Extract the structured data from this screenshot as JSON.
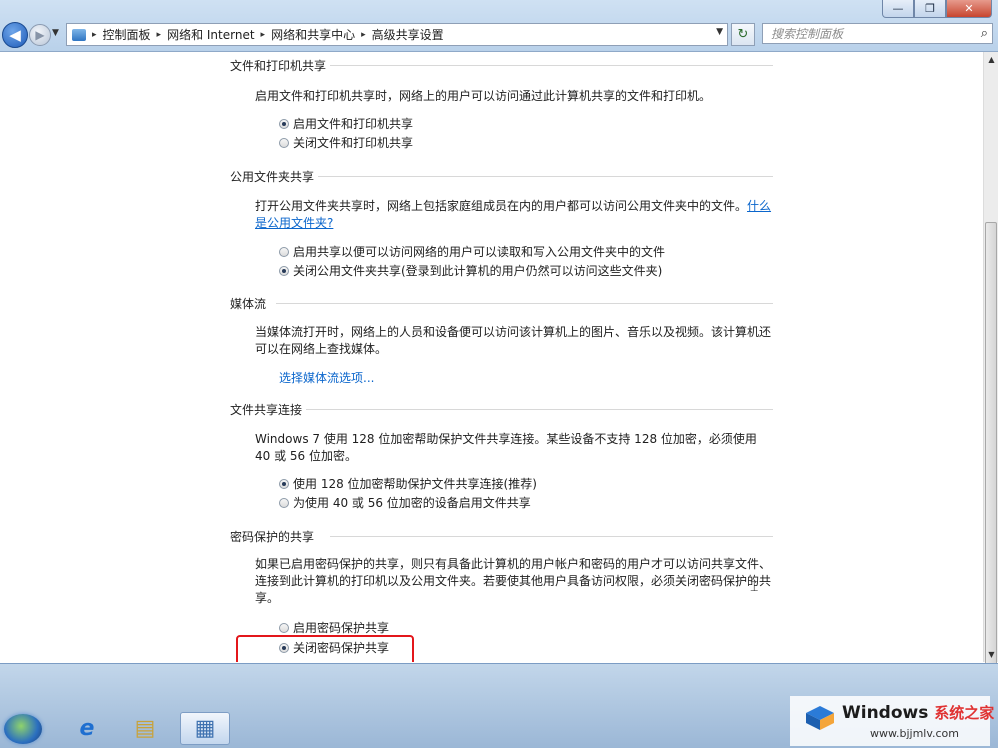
{
  "window": {
    "min_glyph": "—",
    "max_glyph": "❐",
    "close_glyph": "✕"
  },
  "nav": {
    "back_glyph": "◀",
    "fwd_glyph": "▶",
    "hist_glyph": "▼",
    "refresh_glyph": "↻",
    "search_glyph": "⌕"
  },
  "breadcrumb": {
    "sep": "▸",
    "items": [
      "控制面板",
      "网络和 Internet",
      "网络和共享中心",
      "高级共享设置"
    ],
    "dropdown_glyph": "▼"
  },
  "search": {
    "placeholder": "搜索控制面板"
  },
  "sections": [
    {
      "title": "文件和打印机共享",
      "desc": "启用文件和打印机共享时，网络上的用户可以访问通过此计算机共享的文件和打印机。",
      "options": [
        {
          "label": "启用文件和打印机共享",
          "selected": true
        },
        {
          "label": "关闭文件和打印机共享",
          "selected": false
        }
      ]
    },
    {
      "title": "公用文件夹共享",
      "desc": "打开公用文件夹共享时，网络上包括家庭组成员在内的用户都可以访问公用文件夹中的文件。",
      "link": "什么是公用文件夹?",
      "options": [
        {
          "label": "启用共享以便可以访问网络的用户可以读取和写入公用文件夹中的文件",
          "selected": false
        },
        {
          "label": "关闭公用文件夹共享(登录到此计算机的用户仍然可以访问这些文件夹)",
          "selected": true
        }
      ]
    },
    {
      "title": "媒体流",
      "desc": "当媒体流打开时，网络上的人员和设备便可以访问该计算机上的图片、音乐以及视频。该计算机还可以在网络上查找媒体。",
      "link": "选择媒体流选项..."
    },
    {
      "title": "文件共享连接",
      "desc": "Windows 7 使用 128 位加密帮助保护文件共享连接。某些设备不支持 128 位加密，必须使用 40 或 56 位加密。",
      "options": [
        {
          "label": "使用 128 位加密帮助保护文件共享连接(推荐)",
          "selected": true
        },
        {
          "label": "为使用 40 或 56 位加密的设备启用文件共享",
          "selected": false
        }
      ]
    },
    {
      "title": "密码保护的共享",
      "desc": "如果已启用密码保护的共享，则只有具备此计算机的用户帐户和密码的用户才可以访问共享文件、连接到此计算机的打印机以及公用文件夹。若要使其他用户具备访问权限，必须关闭密码保护的共享。",
      "options": [
        {
          "label": "启用密码保护共享",
          "selected": false
        },
        {
          "label": "关闭密码保护共享",
          "selected": true
        }
      ]
    }
  ],
  "taskbar": {
    "ie_glyph": "e",
    "explorer_glyph": "▤",
    "control_glyph": "▦"
  },
  "watermark": {
    "name": "Windows",
    "cn": "系统之家",
    "url": "www.bjjmlv.com"
  },
  "colors": {
    "accent_link": "#0b66cc",
    "highlight_box": "#e3161b"
  }
}
